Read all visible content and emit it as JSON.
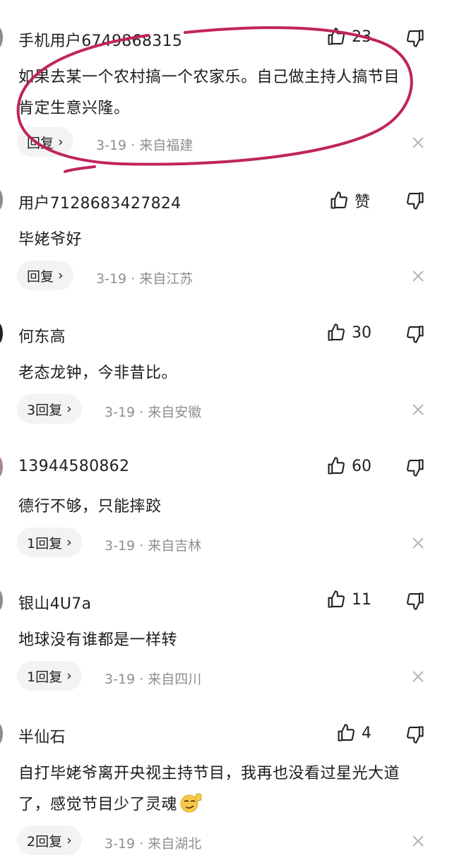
{
  "comments": [
    {
      "username": "手机用户6749868315",
      "likes": "23",
      "lines": [
        "如果去某一个农村搞一个农家乐。自己做主持人搞节目",
        "肯定生意兴隆。"
      ],
      "reply": "回复",
      "date": "3-19 · 来自福建"
    },
    {
      "username": "用户7128683427824",
      "likes": "赞",
      "lines": [
        "毕姥爷好"
      ],
      "reply": "回复",
      "date": "3-19 · 来自江苏"
    },
    {
      "username": "何东高",
      "likes": "30",
      "lines": [
        "老态龙钟，今非昔比。"
      ],
      "reply": "3回复",
      "date": "3-19 · 来自安徽"
    },
    {
      "username": "13944580862",
      "likes": "60",
      "lines": [
        "德行不够，只能摔跤"
      ],
      "reply": "1回复",
      "date": "3-19 · 来自吉林"
    },
    {
      "username": "银山4U7a",
      "likes": "11",
      "lines": [
        "地球没有谁都是一样转"
      ],
      "reply": "1回复",
      "date": "3-19 · 来自四川"
    },
    {
      "username": "半仙石",
      "likes": "4",
      "lines": [
        "自打毕姥爷离开央视主持节目，我再也没看过星光大道",
        "了，感觉节目少了灵魂"
      ],
      "reply": "2回复",
      "date": "3-19 · 来自湖北"
    }
  ],
  "icons": {
    "like": "thumbs-up-icon",
    "dislike": "thumbs-down-icon",
    "reply_arrow": "chevron-right-icon",
    "close": "close-icon",
    "emoji": "smirk-emoji-icon"
  },
  "colors": {
    "annotation_circle": "#c0245e",
    "meta_text": "#8f8f8f",
    "pill_bg": "#f3f3f3"
  }
}
